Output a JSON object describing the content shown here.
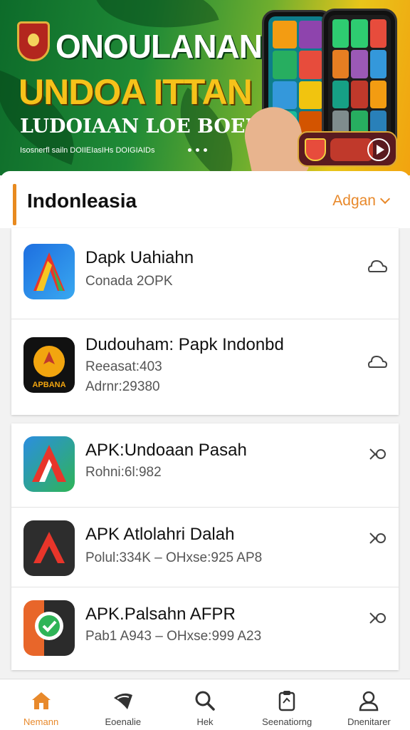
{
  "banner": {
    "line1": "ONOULANAN",
    "line2": "UNDOA ITTAN",
    "line3": "LUDOIAAN LOE BOEL",
    "line4": "Isosnerfl sailn DOIIEIasIHs DOIGIAIDs"
  },
  "section": {
    "title": "Indonleasia",
    "more_label": "Adgan"
  },
  "apps": [
    {
      "name": "Dapk Uahiahn",
      "lines": [
        "Conada 2OPK"
      ],
      "action_icon": "cloud-download-icon"
    },
    {
      "name": "Dudouham: Papk Indonbd",
      "lines": [
        "Reeasat:403",
        "Adrnr:29380"
      ],
      "action_icon": "cloud-download-icon"
    },
    {
      "name": "APK:Undoaan Pasah",
      "lines": [
        "Rohni:6l:982"
      ],
      "action_icon": "close-icon"
    },
    {
      "name": "APK Atlolahri Dalah",
      "lines": [
        "Polul:334K – OHxse:925 AP8"
      ],
      "action_icon": "close-icon"
    },
    {
      "name": "APK.Palsahn AFPR",
      "lines": [
        "Pab1 A943 – OHxse:999 A23"
      ],
      "action_icon": "close-icon"
    }
  ],
  "nav": [
    {
      "label": "Nemann",
      "icon": "home-icon",
      "active": true
    },
    {
      "label": "Eoenalie",
      "icon": "shield-icon",
      "active": false
    },
    {
      "label": "Hek",
      "icon": "search-icon",
      "active": false
    },
    {
      "label": "Seenatiorng",
      "icon": "clipboard-icon",
      "active": false
    },
    {
      "label": "Dnenitarer",
      "icon": "profile-icon",
      "active": false
    }
  ],
  "colors": {
    "accent": "#e8892b",
    "banner_green": "#1f8a36",
    "banner_yellow": "#f6c21a"
  }
}
